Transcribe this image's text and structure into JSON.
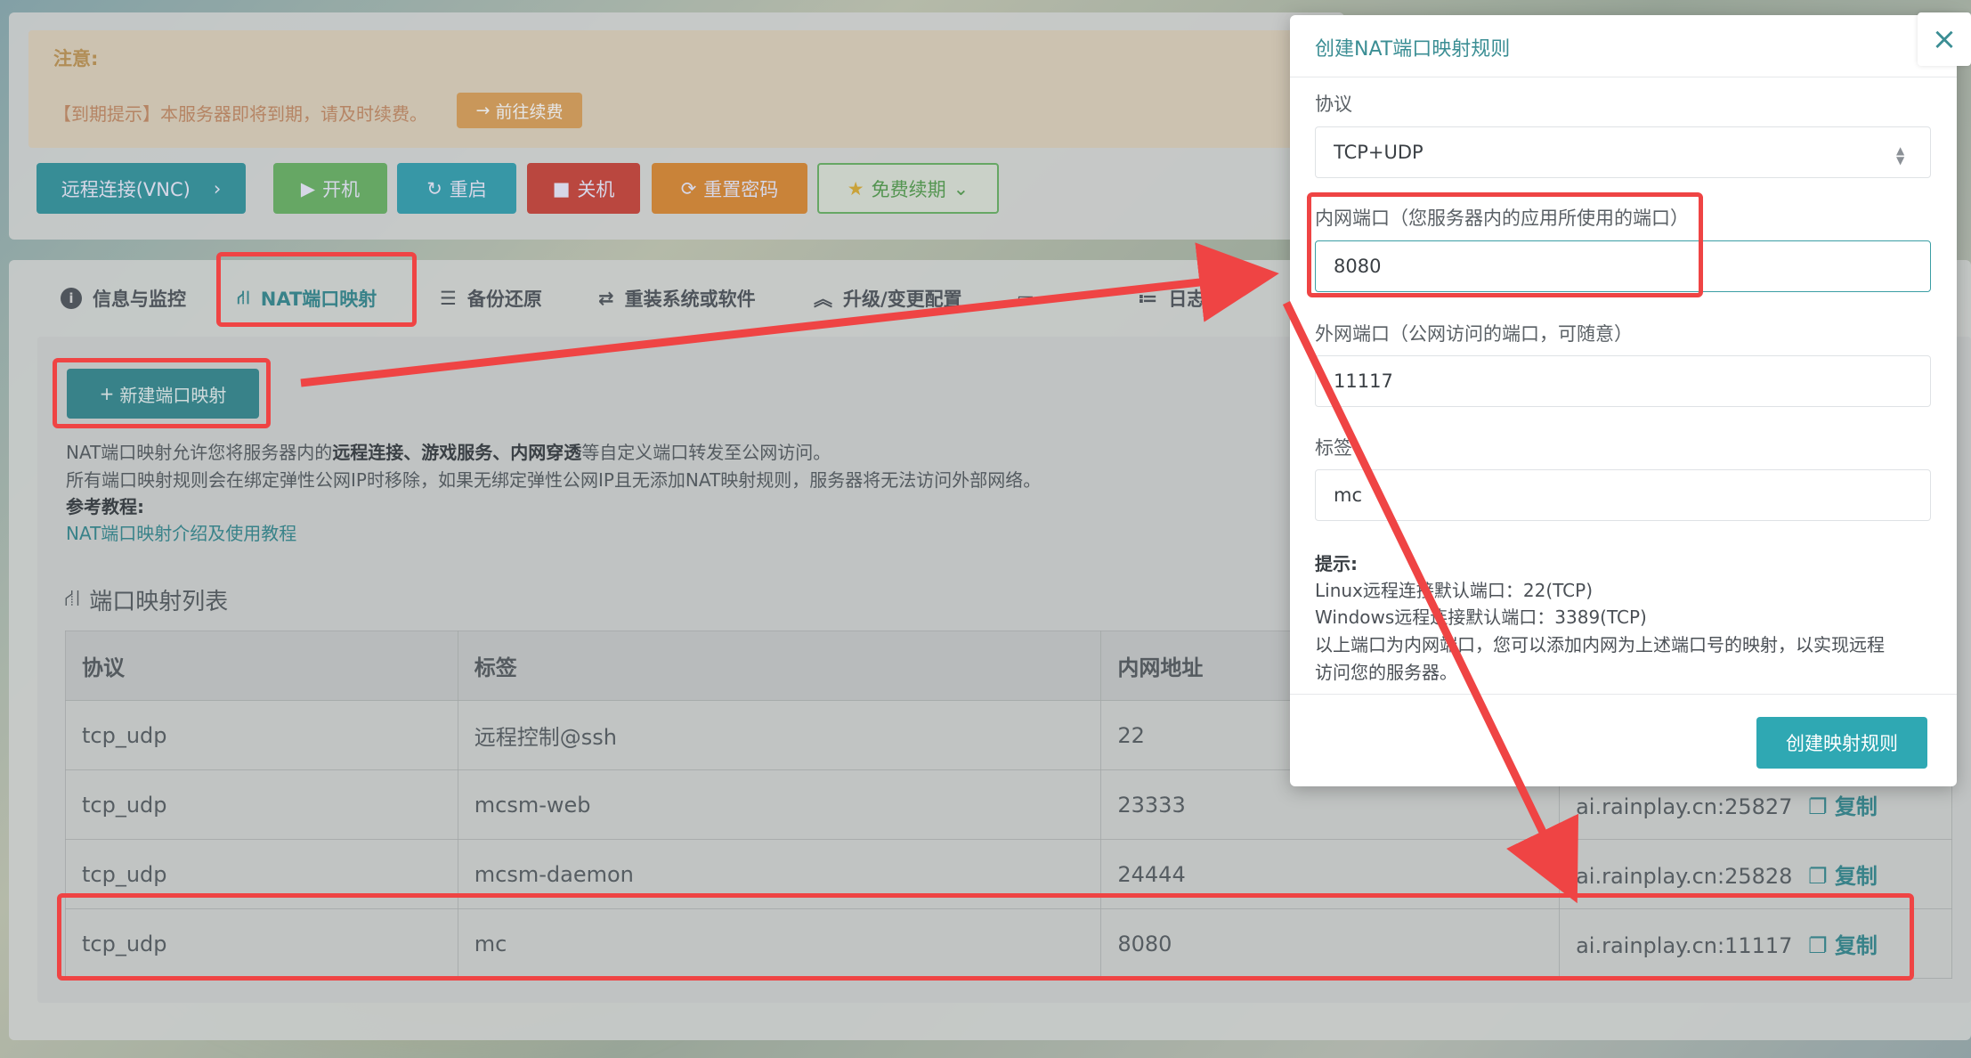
{
  "notice": {
    "title": "注意:",
    "expiry_text": "【到期提示】本服务器即将到期，请及时续费。",
    "renew_button": "前往续费"
  },
  "actions": {
    "vnc": "远程连接(VNC)",
    "start": "开机",
    "restart": "重启",
    "shutdown": "关机",
    "reset_password": "重置密码",
    "free_renew": "免费续期"
  },
  "tabs": [
    {
      "label": "信息与监控"
    },
    {
      "label": "NAT端口映射"
    },
    {
      "label": "备份还原"
    },
    {
      "label": "重装系统或软件"
    },
    {
      "label": "升级/变更配置"
    },
    {
      "label": "日志"
    }
  ],
  "nat": {
    "new_button": "新建端口映射",
    "desc_line1_pre": "NAT端口映射允许您将服务器内的",
    "desc_line1_bold": "远程连接、游戏服务、内网穿透",
    "desc_line1_post": "等自定义端口转发至公网访问。",
    "desc_line2": "所有端口映射规则会在绑定弹性公网IP时移除，如果无绑定弹性公网IP且无添加NAT映射规则，服务器将无法访问外部网络。",
    "tutorial_label": "参考教程:",
    "tutorial_link": "NAT端口映射介绍及使用教程",
    "list_title": "端口映射列表"
  },
  "table": {
    "headers": [
      "协议",
      "标签",
      "内网地址",
      ""
    ],
    "rows": [
      {
        "protocol": "tcp_udp",
        "label": "远程控制@ssh",
        "internal": "22",
        "external": ""
      },
      {
        "protocol": "tcp_udp",
        "label": "mcsm-web",
        "internal": "23333",
        "external": "ai.rainplay.cn:25827"
      },
      {
        "protocol": "tcp_udp",
        "label": "mcsm-daemon",
        "internal": "24444",
        "external": "ai.rainplay.cn:25828"
      },
      {
        "protocol": "tcp_udp",
        "label": "mc",
        "internal": "8080",
        "external": "ai.rainplay.cn:11117"
      }
    ],
    "copy_label": "复制"
  },
  "modal": {
    "title": "创建NAT端口映射规则",
    "close": "×",
    "protocol_label": "协议",
    "protocol_value": "TCP+UDP",
    "internal_label": "内网端口（您服务器内的应用所使用的端口）",
    "internal_value": "8080",
    "external_label": "外网端口（公网访问的端口，可随意）",
    "external_value": "11117",
    "tag_label": "标签",
    "tag_value": "mc",
    "hint_title": "提示:",
    "hint_linux": "Linux远程连接默认端口：22(TCP)",
    "hint_windows": "Windows远程连接默认端口：3389(TCP)",
    "hint_note1": "以上端口为内网端口，您可以添加内网为上述端口号的映射，以实现远程",
    "hint_note2": "访问您的服务器。",
    "submit": "创建映射规则"
  },
  "colors": {
    "accent": "#3b8e94",
    "modal_accent": "#2fa8b3",
    "annotation": "#ef4444",
    "start_btn": "#6fb86a",
    "restart_btn": "#3aa6b5",
    "shutdown_btn": "#d0453c",
    "reset_btn": "#e08f3a"
  }
}
